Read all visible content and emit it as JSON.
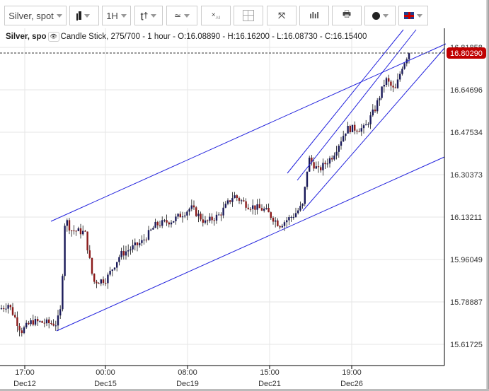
{
  "toolbar": {
    "symbol": "Silver, spot",
    "interval": "1H",
    "icons": [
      "candlestick-icon",
      "interval",
      "drawing-tools-icon",
      "indicators-icon",
      "delete-all-icon",
      "crosshair-icon",
      "fullscreen-icon",
      "volume-icon",
      "print-icon",
      "palette-icon",
      "uk-flag-icon"
    ],
    "delete_all_sub": "All"
  },
  "info": {
    "symbol": "Silver, spo",
    "text": "Candle Stick, 275/700 - 1 hour - O:16.08890 - H:16.16200 - L:16.08730 - C:16.15400"
  },
  "colors": {
    "up": "#1a1a5a",
    "down": "#8b1a1a",
    "trend": "#2222dd",
    "price_tag": "#c00000"
  },
  "chart_data": {
    "type": "candlestick",
    "title": "Silver, spot",
    "current_price": "16.80290",
    "y_ticks": [
      "16.81858",
      "16.64696",
      "16.47534",
      "16.30373",
      "16.13211",
      "15.96049",
      "15.78887",
      "15.61725"
    ],
    "ylim": [
      15.57,
      16.9
    ],
    "x_ticks": [
      {
        "time": "17:00",
        "date": "Dec12"
      },
      {
        "time": "00:00",
        "date": "Dec15"
      },
      {
        "time": "08:00",
        "date": "Dec19"
      },
      {
        "time": "15:00",
        "date": "Dec21"
      },
      {
        "time": "19:00",
        "date": "Dec26"
      }
    ],
    "close_path": [
      [
        0,
        15.76
      ],
      [
        12,
        15.78
      ],
      [
        22,
        15.72
      ],
      [
        30,
        15.67
      ],
      [
        45,
        15.71
      ],
      [
        80,
        15.7
      ],
      [
        86,
        15.76
      ],
      [
        92,
        16.13
      ],
      [
        100,
        16.08
      ],
      [
        120,
        16.07
      ],
      [
        132,
        15.87
      ],
      [
        150,
        15.88
      ],
      [
        170,
        15.98
      ],
      [
        200,
        16.03
      ],
      [
        220,
        16.1
      ],
      [
        245,
        16.12
      ],
      [
        270,
        16.17
      ],
      [
        290,
        16.11
      ],
      [
        310,
        16.14
      ],
      [
        330,
        16.22
      ],
      [
        350,
        16.18
      ],
      [
        375,
        16.16
      ],
      [
        395,
        16.1
      ],
      [
        415,
        16.14
      ],
      [
        428,
        16.18
      ],
      [
        436,
        16.37
      ],
      [
        450,
        16.32
      ],
      [
        470,
        16.38
      ],
      [
        490,
        16.49
      ],
      [
        515,
        16.49
      ],
      [
        530,
        16.57
      ],
      [
        545,
        16.69
      ],
      [
        558,
        16.64
      ],
      [
        568,
        16.74
      ],
      [
        578,
        16.8
      ]
    ]
  }
}
